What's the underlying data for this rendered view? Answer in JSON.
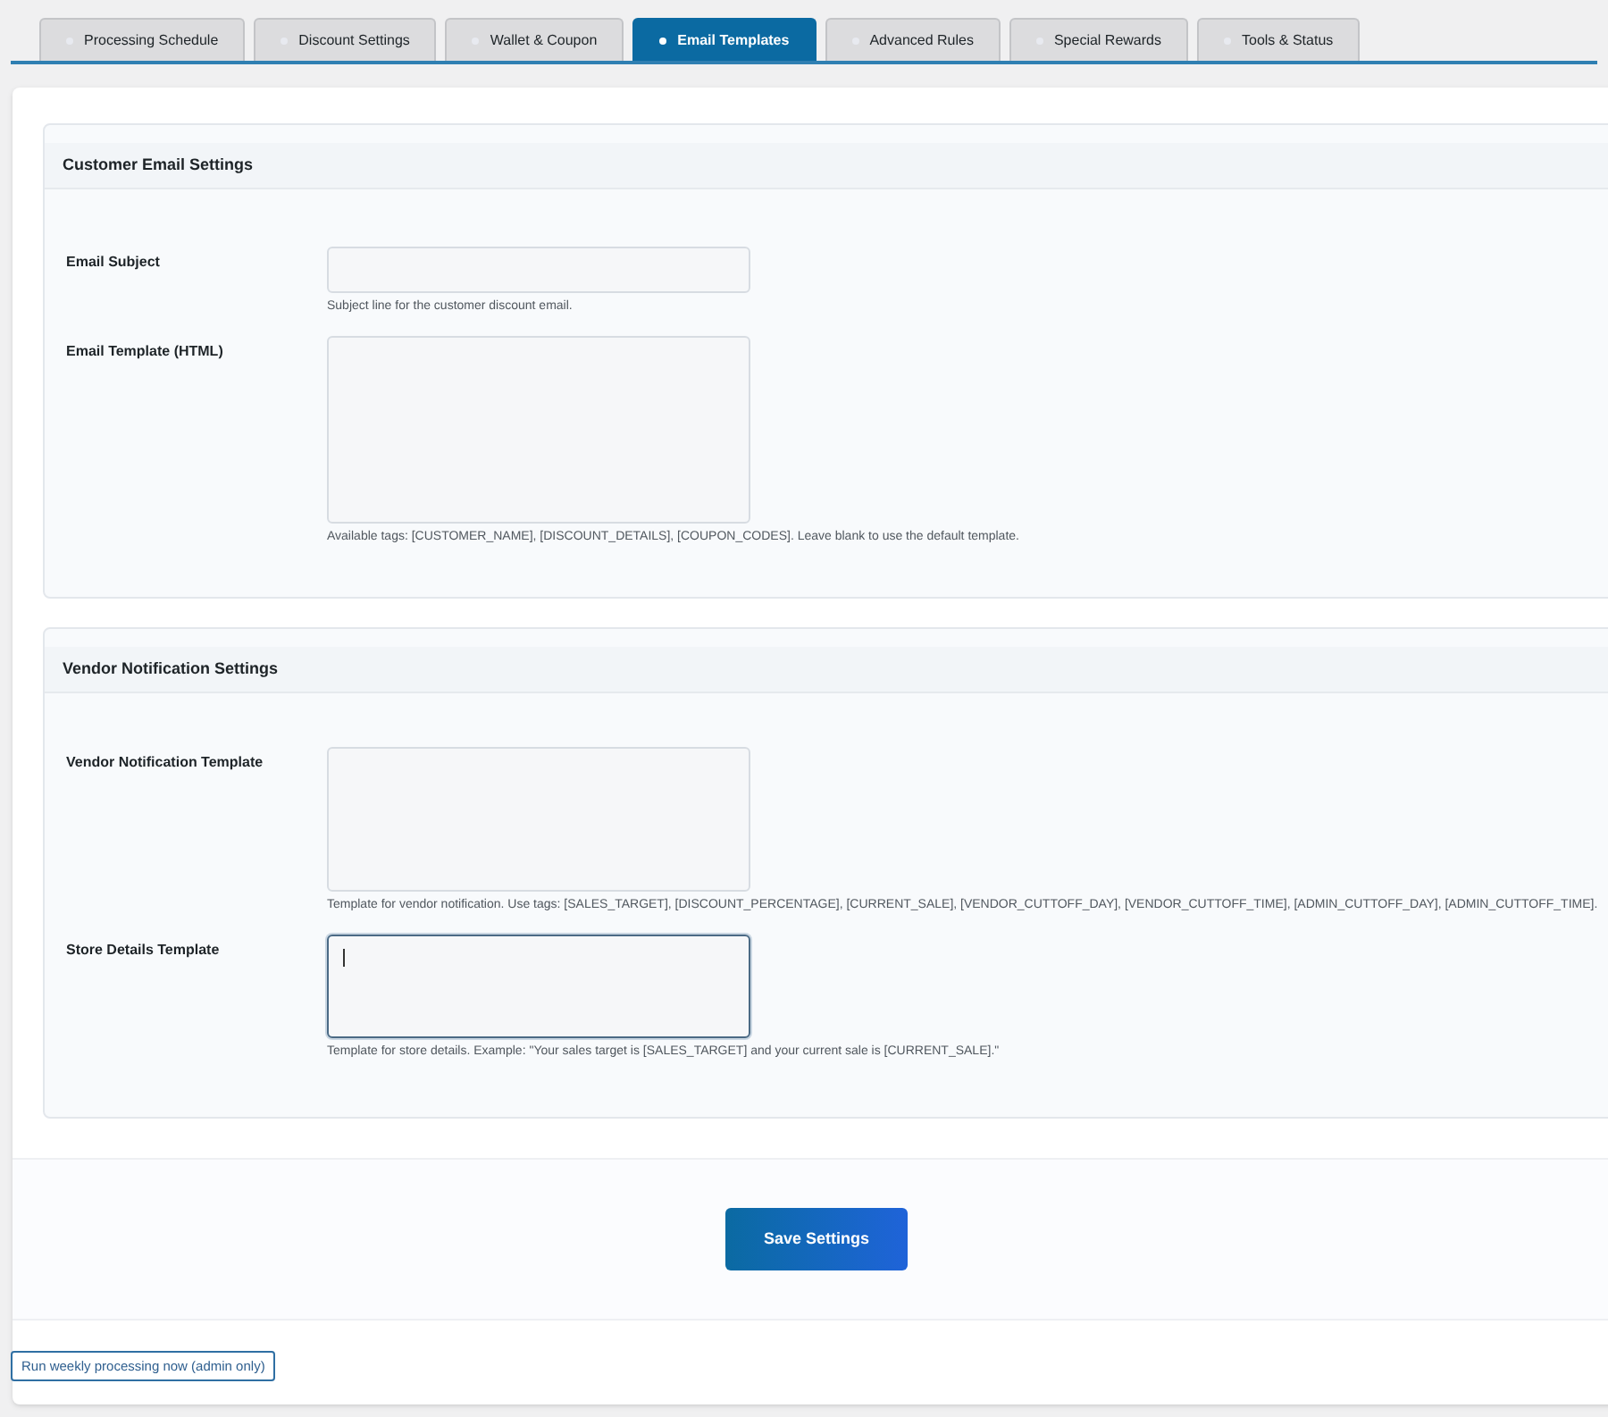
{
  "tabs": [
    {
      "label": "Processing Schedule",
      "selected": false
    },
    {
      "label": "Discount Settings",
      "selected": false
    },
    {
      "label": "Wallet & Coupon",
      "selected": false
    },
    {
      "label": "Email Templates",
      "selected": true
    },
    {
      "label": "Advanced Rules",
      "selected": false
    },
    {
      "label": "Special Rewards",
      "selected": false
    },
    {
      "label": "Tools & Status",
      "selected": false
    }
  ],
  "sections": [
    {
      "title": "Customer Email Settings",
      "fields": [
        {
          "label": "Email Subject",
          "kind": "text",
          "focused": false,
          "help": "Subject line for the customer discount email."
        },
        {
          "label": "Email Template (HTML)",
          "kind": "textarea",
          "focused": false,
          "help": "Available tags: [CUSTOMER_NAME], [DISCOUNT_DETAILS], [COUPON_CODES]. Leave blank to use the default template."
        }
      ]
    },
    {
      "title": "Vendor Notification Settings",
      "fields": [
        {
          "label": "Vendor Notification Template",
          "kind": "textarea",
          "focused": false,
          "help": "Template for vendor notification. Use tags: [SALES_TARGET], [DISCOUNT_PERCENTAGE], [CURRENT_SALE], [VENDOR_CUTTOFF_DAY], [VENDOR_CUTTOFF_TIME], [ADMIN_CUTTOFF_DAY], [ADMIN_CUTTOFF_TIME]."
        },
        {
          "label": "Store Details Template",
          "kind": "textarea-small",
          "focused": true,
          "help": "Template for store details. Example: \"Your sales target is [SALES_TARGET] and your current sale is [CURRENT_SALE].\""
        }
      ]
    }
  ],
  "save_button": "Save Settings",
  "run_button": "Run weekly processing now (admin only)"
}
